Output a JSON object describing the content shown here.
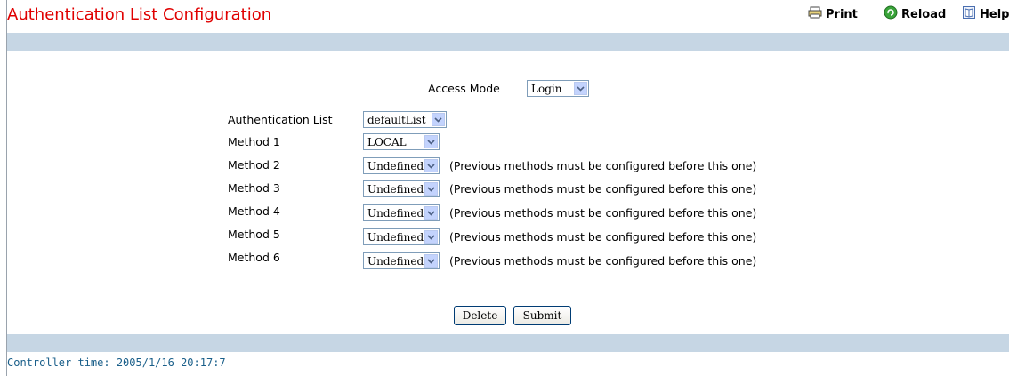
{
  "header": {
    "title": "Authentication List Configuration",
    "print_label": "Print",
    "reload_label": "Reload",
    "help_label": "Help"
  },
  "form": {
    "access_mode_label": "Access Mode",
    "access_mode_value": "Login",
    "auth_list_label": "Authentication List",
    "auth_list_value": "defaultList",
    "methods": [
      {
        "label": "Method 1",
        "value": "LOCAL",
        "note": ""
      },
      {
        "label": "Method 2",
        "value": "Undefined",
        "note": "(Previous methods must be configured before this one)"
      },
      {
        "label": "Method 3",
        "value": "Undefined",
        "note": "(Previous methods must be configured before this one)"
      },
      {
        "label": "Method 4",
        "value": "Undefined",
        "note": "(Previous methods must be configured before this one)"
      },
      {
        "label": "Method 5",
        "value": "Undefined",
        "note": "(Previous methods must be configured before this one)"
      },
      {
        "label": "Method 6",
        "value": "Undefined",
        "note": "(Previous methods must be configured before this one)"
      }
    ]
  },
  "buttons": {
    "delete_label": "Delete",
    "submit_label": "Submit"
  },
  "footer": {
    "controller_time": "Controller time: 2005/1/16 20:17:7"
  },
  "colors": {
    "title": "#e00000",
    "band": "#c6d6e4",
    "footer_text": "#1a5f8a"
  }
}
